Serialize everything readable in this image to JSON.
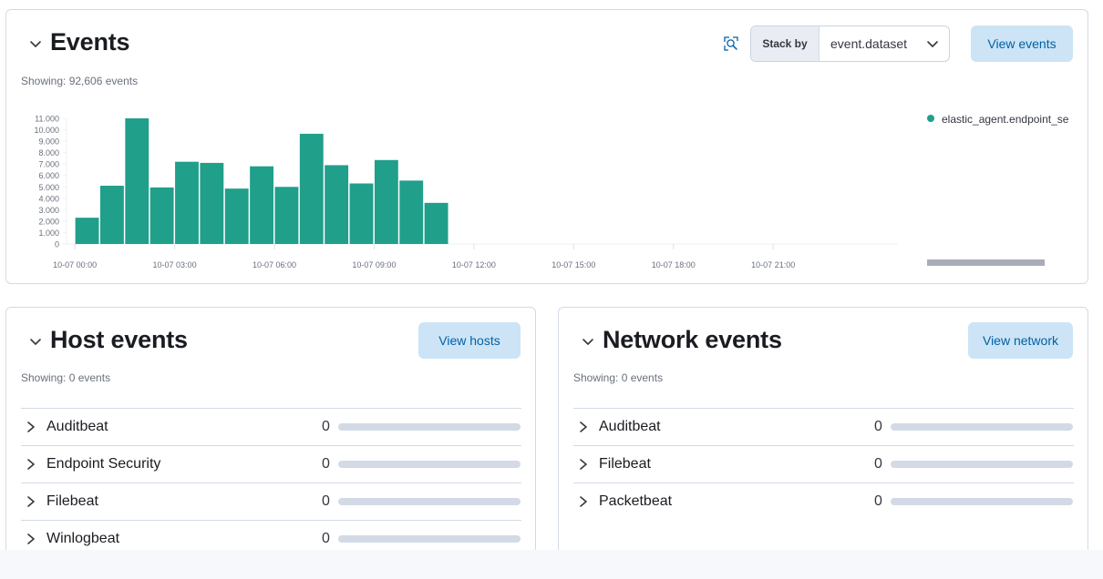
{
  "events": {
    "title": "Events",
    "showing": "Showing: 92,606 events",
    "stack_by_label": "Stack by",
    "stack_by_value": "event.dataset",
    "view_button": "View events",
    "legend": {
      "label": "elastic_agent.endpoint_se",
      "color": "#209f8b"
    }
  },
  "chart_data": {
    "type": "bar",
    "series": [
      {
        "name": "elastic_agent.endpoint_se",
        "color": "#209f8b",
        "values": [
          2300,
          5100,
          11000,
          4950,
          7200,
          7100,
          4850,
          6800,
          5000,
          9650,
          6900,
          5300,
          7350,
          5550,
          3600
        ]
      }
    ],
    "bin_hours": 0.75,
    "x_start_hour": 0,
    "x_range_hours": [
      -0.25,
      24.75
    ],
    "x_ticks": [
      {
        "hour": 0,
        "label": "10-07 00:00"
      },
      {
        "hour": 3,
        "label": "10-07 03:00"
      },
      {
        "hour": 6,
        "label": "10-07 06:00"
      },
      {
        "hour": 9,
        "label": "10-07 09:00"
      },
      {
        "hour": 12,
        "label": "10-07 12:00"
      },
      {
        "hour": 15,
        "label": "10-07 15:00"
      },
      {
        "hour": 18,
        "label": "10-07 18:00"
      },
      {
        "hour": 21,
        "label": "10-07 21:00"
      }
    ],
    "y_ticks": [
      "0",
      "1.000",
      "2.000",
      "3.000",
      "4.000",
      "5.000",
      "6.000",
      "7.000",
      "8.000",
      "9.000",
      "10.000",
      "11.000"
    ],
    "ylim": [
      0,
      11000
    ],
    "grid": false,
    "legend_position": "right"
  },
  "host": {
    "title": "Host events",
    "showing": "Showing: 0 events",
    "view_button": "View hosts",
    "rows": [
      {
        "label": "Auditbeat",
        "count": "0",
        "fraction": 0
      },
      {
        "label": "Endpoint Security",
        "count": "0",
        "fraction": 0
      },
      {
        "label": "Filebeat",
        "count": "0",
        "fraction": 0
      },
      {
        "label": "Winlogbeat",
        "count": "0",
        "fraction": 0
      }
    ]
  },
  "network": {
    "title": "Network events",
    "showing": "Showing: 0 events",
    "view_button": "View network",
    "rows": [
      {
        "label": "Auditbeat",
        "count": "0",
        "fraction": 0
      },
      {
        "label": "Filebeat",
        "count": "0",
        "fraction": 0
      },
      {
        "label": "Packetbeat",
        "count": "0",
        "fraction": 0
      }
    ]
  }
}
